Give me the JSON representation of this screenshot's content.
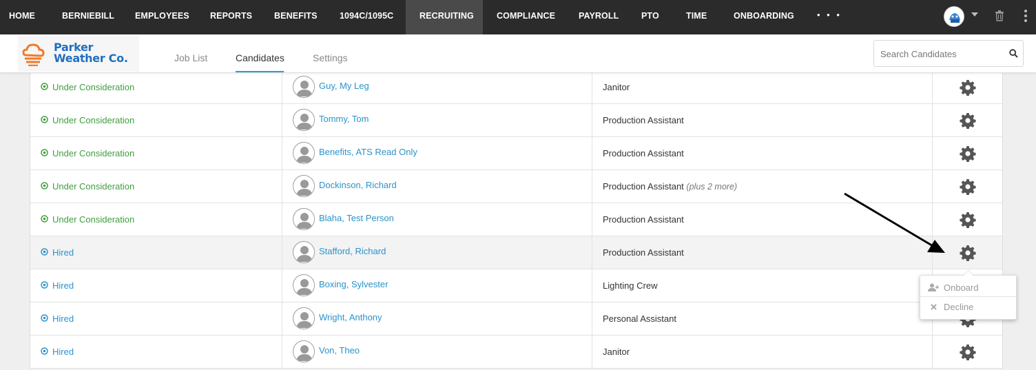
{
  "nav": {
    "items": [
      "HOME",
      "BERNIEBILL",
      "EMPLOYEES",
      "REPORTS",
      "BENEFITS",
      "1094C/1095C",
      "RECRUITING",
      "COMPLIANCE",
      "PAYROLL",
      "PTO",
      "TIME",
      "ONBOARDING"
    ],
    "active": "RECRUITING",
    "more": "• • •"
  },
  "logo": {
    "line1": "Parker",
    "line2": "Weather Co."
  },
  "tabs": [
    "Job List",
    "Candidates",
    "Settings"
  ],
  "active_tab": "Candidates",
  "search": {
    "placeholder": "Search Candidates"
  },
  "candidates": [
    {
      "status": "Under Consideration",
      "name": "Guy, My Leg",
      "job": "Janitor",
      "more": ""
    },
    {
      "status": "Under Consideration",
      "name": "Tommy, Tom",
      "job": "Production Assistant",
      "more": ""
    },
    {
      "status": "Under Consideration",
      "name": "Benefits, ATS Read Only",
      "job": "Production Assistant",
      "more": ""
    },
    {
      "status": "Under Consideration",
      "name": "Dockinson, Richard",
      "job": "Production Assistant",
      "more": "(plus 2 more)"
    },
    {
      "status": "Under Consideration",
      "name": "Blaha, Test Person",
      "job": "Production Assistant",
      "more": ""
    },
    {
      "status": "Hired",
      "name": "Stafford, Richard",
      "job": "Production Assistant",
      "more": ""
    },
    {
      "status": "Hired",
      "name": "Boxing, Sylvester",
      "job": "Lighting Crew",
      "more": ""
    },
    {
      "status": "Hired",
      "name": "Wright, Anthony",
      "job": "Personal Assistant",
      "more": ""
    },
    {
      "status": "Hired",
      "name": "Von, Theo",
      "job": "Janitor",
      "more": ""
    }
  ],
  "dropdown": {
    "onboard": "Onboard",
    "decline": "Decline"
  },
  "colors": {
    "nav_bg": "#2b2b2b",
    "consider": "#3f9e3f",
    "hired": "#2a93c9",
    "link": "#2a93c9",
    "tab_underline": "#2aa0c9"
  }
}
